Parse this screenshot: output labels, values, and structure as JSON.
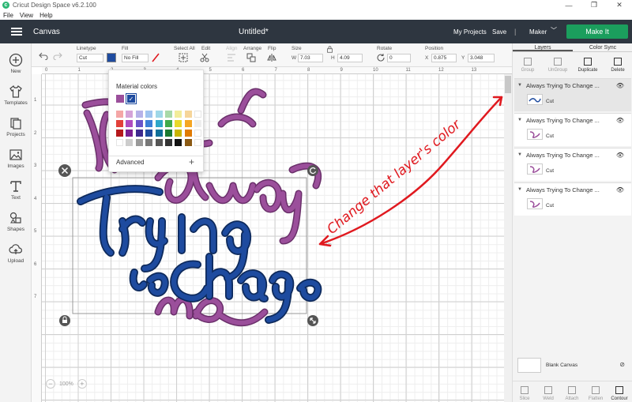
{
  "window": {
    "title": "Cricut Design Space  v6.2.100",
    "controls": [
      "—",
      "❐",
      "✕"
    ]
  },
  "menu": [
    "File",
    "View",
    "Help"
  ],
  "header": {
    "section": "Canvas",
    "doc_title": "Untitled*",
    "my_projects": "My Projects",
    "save": "Save",
    "separator": "|",
    "machine": "Maker",
    "make_it": "Make It"
  },
  "sidebar": [
    {
      "label": "New",
      "icon": "plus-circle-icon"
    },
    {
      "label": "Templates",
      "icon": "shirt-icon"
    },
    {
      "label": "Projects",
      "icon": "projects-icon"
    },
    {
      "label": "Images",
      "icon": "image-icon"
    },
    {
      "label": "Text",
      "icon": "text-icon"
    },
    {
      "label": "Shapes",
      "icon": "shapes-icon"
    },
    {
      "label": "Upload",
      "icon": "upload-icon"
    }
  ],
  "toolbar": {
    "linetype_label": "Linetype",
    "linetype_value": "Cut",
    "fill_label": "Fill",
    "fill_value": "No Fill",
    "select_all": "Select All",
    "edit": "Edit",
    "align": "Align",
    "arrange": "Arrange",
    "flip": "Flip",
    "size_label": "Size",
    "w_label": "W",
    "w_value": "7.03",
    "h_label": "H",
    "h_value": "4.09",
    "rotate_label": "Rotate",
    "rotate_value": "0",
    "position_label": "Position",
    "x_label": "X",
    "x_value": "0.875",
    "y_label": "Y",
    "y_value": "3.048",
    "current_color": "#1e4b9f"
  },
  "ruler": {
    "top": [
      "0",
      "1",
      "2",
      "3",
      "4",
      "5",
      "6",
      "7",
      "8",
      "9",
      "10",
      "11",
      "12",
      "13"
    ],
    "left": [
      "1",
      "2",
      "3",
      "4",
      "5",
      "6",
      "7"
    ]
  },
  "canvas": {
    "artwork_lines": [
      "Always",
      "Trying",
      "to",
      "Change",
      "me"
    ],
    "dimension_label": "4.09in",
    "annotation": "Change that layer's color",
    "zoom": "100%",
    "zoom_minus": "−",
    "zoom_plus": "+"
  },
  "material_popup": {
    "title": "Material colors",
    "current_colors": [
      "#9b4f9b",
      "#1e4b9f"
    ],
    "palette": [
      "#f4a6a6",
      "#d5a3d8",
      "#b6b2e8",
      "#9fc4ef",
      "#9fd7e8",
      "#a8d9a8",
      "#f2ec9a",
      "#f6d59a",
      "#ffffff",
      "#e2403a",
      "#b04cc0",
      "#6a55c9",
      "#3b7fd6",
      "#2fa7c9",
      "#3faa4a",
      "#e8d82a",
      "#f5a623",
      "#eeeeee",
      "#b5191c",
      "#7a1f92",
      "#3e2a8f",
      "#1e4b9f",
      "#0f6f99",
      "#1b7a31",
      "#c9b400",
      "#e07b00",
      "#ffffff",
      "#ffffff",
      "#cccccc",
      "#999999",
      "#777777",
      "#555555",
      "#333333",
      "#111111",
      "#8b5a14",
      "#ffffff"
    ],
    "advanced": "Advanced",
    "plus": "+"
  },
  "right_panel": {
    "tabs": [
      "Layers",
      "Color Sync"
    ],
    "actions": [
      "Group",
      "UnGroup",
      "Duplicate",
      "Delete"
    ],
    "layers": [
      {
        "name": "Always Trying To Change ...",
        "type": "Cut",
        "selected": true
      },
      {
        "name": "Always Trying To Change ...",
        "type": "Cut",
        "selected": false
      },
      {
        "name": "Always Trying To Change ...",
        "type": "Cut",
        "selected": false
      },
      {
        "name": "Always Trying To Change ...",
        "type": "Cut",
        "selected": false
      }
    ],
    "blank_canvas": "Blank Canvas",
    "bottom_actions": [
      "Slice",
      "Weld",
      "Attach",
      "Flatten",
      "Contour"
    ]
  },
  "colors": {
    "header": "#2e3640",
    "make_it": "#1b9e5d",
    "purple": "#9b4f9b",
    "blue": "#1e4b9f",
    "annotation": "#e0191f"
  }
}
